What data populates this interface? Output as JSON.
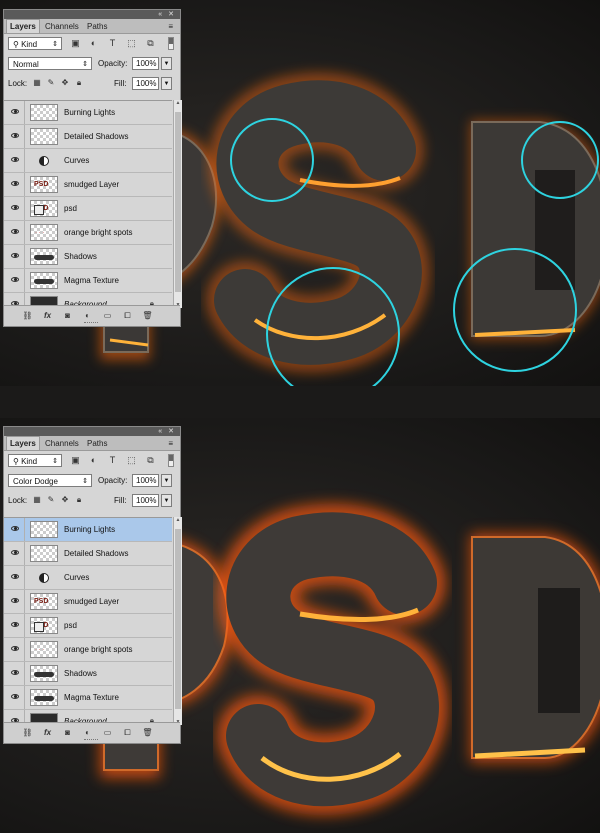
{
  "colors": {
    "highlight": "#2ed3e0",
    "lava": "#ff7a1a",
    "selected_row": "#aac8ea"
  },
  "artwork": {
    "text": "PSD"
  },
  "screenshots": [
    {
      "panel": {
        "tabs": [
          "Layers",
          "Channels",
          "Paths"
        ],
        "filter_kind": "Kind",
        "blend_mode": "Normal",
        "opacity_label": "Opacity:",
        "opacity_value": "100%",
        "lock_label": "Lock:",
        "fill_label": "Fill:",
        "fill_value": "100%",
        "selected_layer": "",
        "layers": [
          {
            "name": "Burning Lights",
            "thumb": "transparent"
          },
          {
            "name": "Detailed Shadows",
            "thumb": "transparent"
          },
          {
            "name": "Curves",
            "thumb": "adjustment"
          },
          {
            "name": "smudged Layer",
            "thumb": "psd"
          },
          {
            "name": "psd",
            "thumb": "psd-smart"
          },
          {
            "name": "orange bright spots",
            "thumb": "spots"
          },
          {
            "name": "Shadows",
            "thumb": "blob"
          },
          {
            "name": "Magma Texture",
            "thumb": "blob"
          },
          {
            "name": "Background",
            "thumb": "dark",
            "locked": true
          }
        ]
      }
    },
    {
      "panel": {
        "tabs": [
          "Layers",
          "Channels",
          "Paths"
        ],
        "filter_kind": "Kind",
        "blend_mode": "Color Dodge",
        "opacity_label": "Opacity:",
        "opacity_value": "100%",
        "lock_label": "Lock:",
        "fill_label": "Fill:",
        "fill_value": "100%",
        "selected_layer": "Burning Lights",
        "layers": [
          {
            "name": "Burning Lights",
            "thumb": "transparent"
          },
          {
            "name": "Detailed Shadows",
            "thumb": "transparent"
          },
          {
            "name": "Curves",
            "thumb": "adjustment"
          },
          {
            "name": "smudged Layer",
            "thumb": "psd"
          },
          {
            "name": "psd",
            "thumb": "psd-smart"
          },
          {
            "name": "orange bright spots",
            "thumb": "spots"
          },
          {
            "name": "Shadows",
            "thumb": "blob"
          },
          {
            "name": "Magma Texture",
            "thumb": "blob"
          },
          {
            "name": "Background",
            "thumb": "dark",
            "locked": true
          }
        ]
      }
    }
  ]
}
